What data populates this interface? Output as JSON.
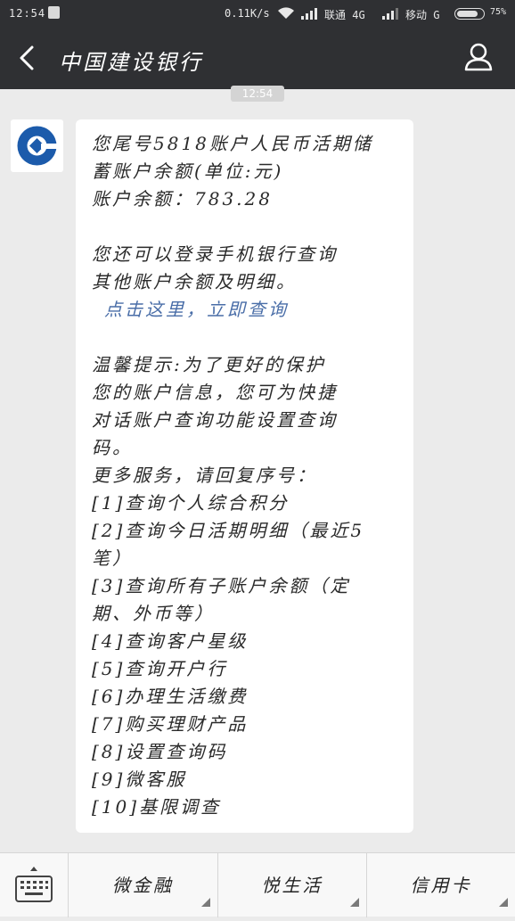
{
  "status_bar": {
    "time": "12:54",
    "net_speed": "0.11K/s",
    "carrier1": "联通 4G",
    "carrier2": "移动 G",
    "battery_percent": 75,
    "battery_label": "75%"
  },
  "header": {
    "title": "中国建设银行"
  },
  "chat": {
    "timestamp": "12:54",
    "message": {
      "lines_a": [
        "您尾号5818账户人民币活期储",
        "蓄账户余额(单位:元)",
        "账户余额：783.28"
      ],
      "lines_b": [
        "您还可以登录手机银行查询",
        "其他账户余额及明细。"
      ],
      "link": "点击这里，立即查询",
      "lines_c": [
        "温馨提示:为了更好的保护",
        "您的账户信息，您可为快捷",
        "对话账户查询功能设置查询",
        "码。",
        "更多服务，请回复序号：",
        "[1]查询个人综合积分",
        "[2]查询今日活期明细（最近5",
        "笔）",
        "[3]查询所有子账户余额（定",
        "期、外币等）",
        "[4]查询客户星级",
        "[5]查询开户行",
        "[6]办理生活缴费",
        "[7]购买理财产品",
        "[8]设置查询码",
        "[9]微客服",
        "[10]基限调查"
      ]
    }
  },
  "bottom_menu": {
    "items": [
      {
        "label": "微金融"
      },
      {
        "label": "悦生活"
      },
      {
        "label": "信用卡"
      }
    ]
  },
  "colors": {
    "bar_bg": "#2f3033",
    "chat_bg": "#ebebeb",
    "link": "#4a6ea8",
    "logo": "#1c5bab"
  },
  "icons": {
    "back": "chevron-left-icon",
    "profile": "person-icon",
    "keyboard": "keyboard-icon",
    "logo": "ccb-logo"
  }
}
